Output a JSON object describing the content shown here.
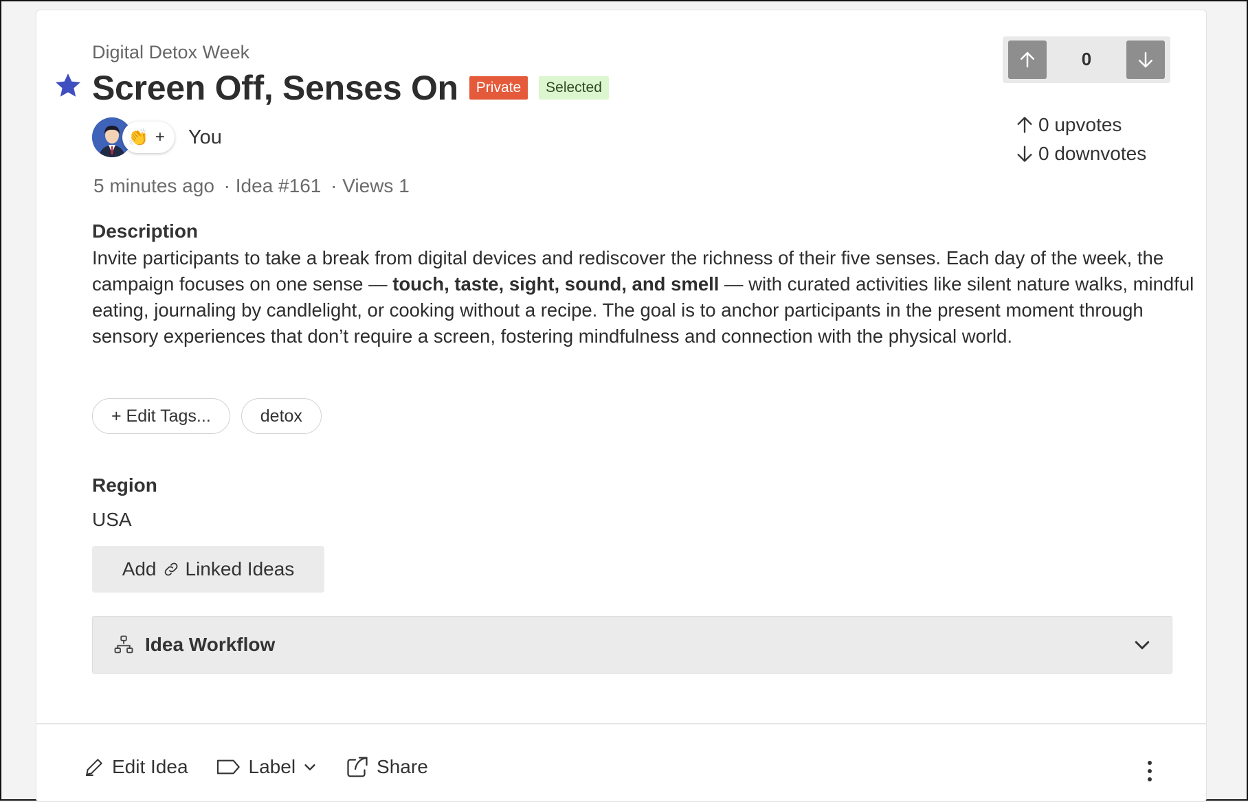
{
  "idea": {
    "campaign": "Digital Detox Week",
    "title": "Screen Off, Senses On",
    "badges": {
      "private": "Private",
      "selected": "Selected"
    },
    "author": "You",
    "reaction_plus": "+",
    "meta": {
      "time": "5 minutes ago",
      "idea_no": "· Idea #161",
      "views": "· Views 1"
    }
  },
  "description": {
    "label": "Description",
    "text_before": "Invite participants to take a break from digital devices and rediscover the richness of their five senses. Each day of the week, the campaign focuses on one sense — ",
    "text_bold": "touch, taste, sight, sound, and smell",
    "text_after": " — with curated activities like silent nature walks, mindful eating, journaling by candlelight, or cooking without a recipe. The goal is to anchor participants in the present moment through sensory experiences that don’t require a screen, fostering mindfulness and connection with the physical world."
  },
  "tags": {
    "edit_label": "+ Edit Tags...",
    "items": [
      "detox"
    ]
  },
  "region": {
    "label": "Region",
    "value": "USA"
  },
  "linked": {
    "add": "Add",
    "label": "Linked Ideas"
  },
  "workflow": {
    "label": "Idea Workflow"
  },
  "votes": {
    "count": "0",
    "upvotes": "0 upvotes",
    "downvotes": "0 downvotes"
  },
  "footer": {
    "edit": "Edit Idea",
    "label": "Label",
    "share": "Share"
  },
  "colors": {
    "star": "#3f4fbf",
    "private_bg": "#e55a3a",
    "selected_bg": "#dcf7cf",
    "vote_btn": "#8e8e8e"
  }
}
